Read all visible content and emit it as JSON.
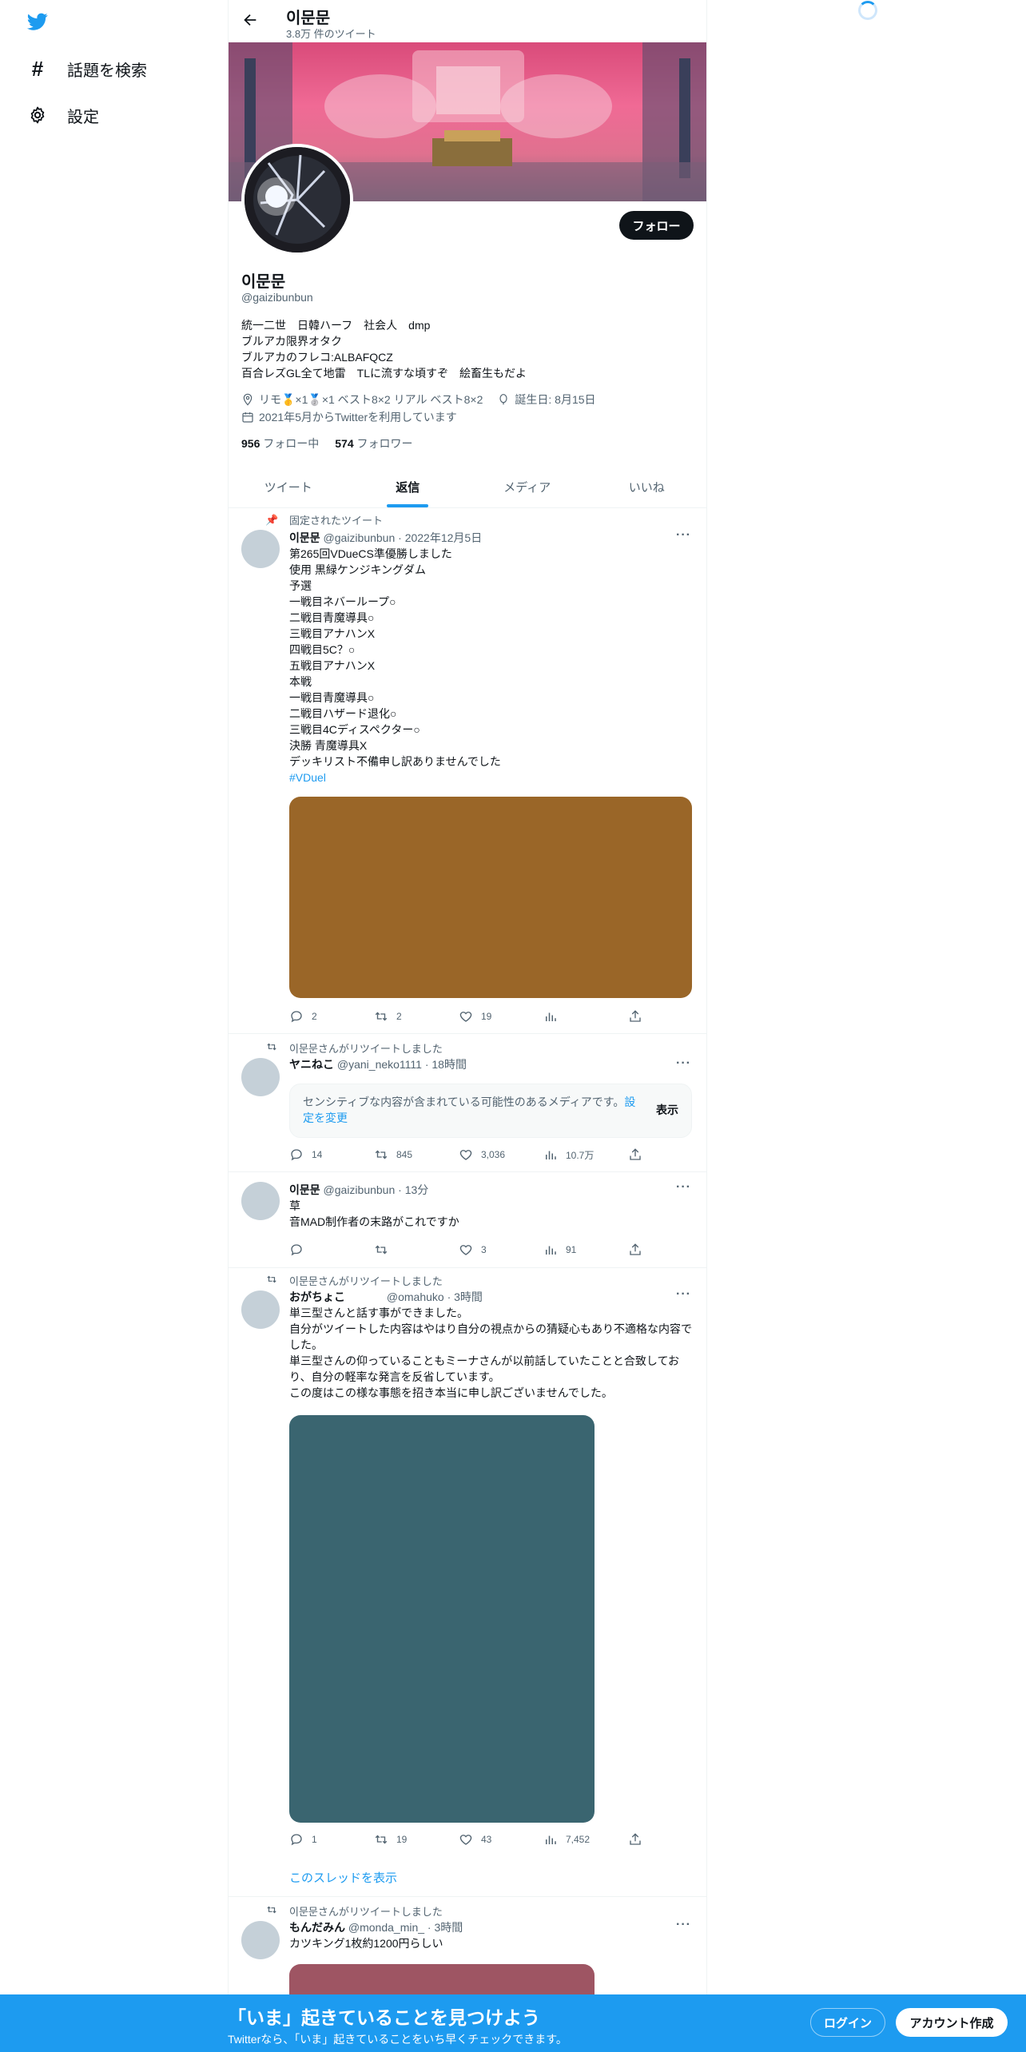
{
  "nav": {
    "explore_label": "話題を検索",
    "settings_label": "設定"
  },
  "header": {
    "name": "이문문",
    "tweet_count": "3.8万 件のツイート"
  },
  "profile": {
    "follow_label": "フォロー",
    "name": "이문문",
    "handle": "@gaizibunbun",
    "bio": "統一二世　日韓ハーフ　社会人　dmp\nブルアカ限界オタク\nブルアカのフレコ:ALBAFQCZ\n百合レズGL全て地雷　TLに流すな頃すぞ　絵畜生もだよ",
    "location": "リモ🥇×1🥈×1 ベスト8×2 リアル ベスト8×2",
    "birthday": "誕生日: 8月15日",
    "joined": "2021年5月からTwitterを利用しています",
    "following_count": "956",
    "following_label": "フォロー中",
    "followers_count": "574",
    "followers_label": "フォロワー"
  },
  "tabs": [
    {
      "label": "ツイート"
    },
    {
      "label": "返信"
    },
    {
      "label": "メディア"
    },
    {
      "label": "いいね"
    }
  ],
  "tweets": [
    {
      "context": "固定されたツイート",
      "name": "이문문",
      "handle_time": "@gaizibunbun · 2022年12月5日",
      "body": "第265回VDueCS準優勝しました\n使用 黒緑ケンジキングダム\n予選\n一戦目ネバーループ○\n二戦目青魔導具○\n三戦目アナハンX\n四戦目5C？○\n五戦目アナハンX\n本戦\n一戦目青魔導具○\n二戦目ハザード退化○\n三戦目4Cディスペクター○\n決勝 青魔導具X\nデッキリスト不備申し訳ありませんでした",
      "hashtag": "#VDuel",
      "media_color": "#9a6628",
      "replies": "2",
      "retweets": "2",
      "likes": "19",
      "views": ""
    },
    {
      "context": "이문문さんがリツイートしました",
      "name": "ヤニねこ",
      "handle_time": "@yani_neko1111 · 18時間",
      "sensitive_text": "センシティブな内容が含まれている可能性のあるメディアです。",
      "sensitive_link": "設定を変更",
      "sensitive_show": "表示",
      "replies": "14",
      "retweets": "845",
      "likes": "3,036",
      "views": "10.7万"
    },
    {
      "name": "이문문",
      "handle_time": "@gaizibunbun · 13分",
      "body": "草\n音MAD制作者の末路がこれですか",
      "replies": "",
      "retweets": "",
      "likes": "3",
      "views": "91"
    },
    {
      "context": "이문문さんがリツイートしました",
      "name": "おがちょこ",
      "handle_time": "@omahuko · 3時間",
      "body": "単三型さんと話す事ができました。\n自分がツイートした内容はやはり自分の視点からの猜疑心もあり不適格な内容でした。\n単三型さんの仰っていることもミーナさんが以前話していたことと合致しており、自分の軽率な発言を反省しています。\nこの度はこの様な事態を招き本当に申し訳ございませんでした。",
      "media_color": "#3a6570",
      "replies": "1",
      "retweets": "19",
      "likes": "43",
      "views": "7,452",
      "thread_link": "このスレッドを表示"
    },
    {
      "context": "이문문さんがリツイートしました",
      "name": "もんだみん",
      "handle_time": "@monda_min_ · 3時間",
      "body": "カツキング1枚約1200円らしい",
      "media_color": "#9e5563"
    }
  ],
  "bottom_bar": {
    "title": "「いま」起きていることを見つけよう",
    "subtitle": "Twitterなら、「いま」起きていることをいち早くチェックできます。",
    "login_label": "ログイン",
    "signup_label": "アカウント作成"
  },
  "colors": {
    "accent": "#1d9bf0",
    "text": "#0f1419",
    "muted": "#536471"
  }
}
